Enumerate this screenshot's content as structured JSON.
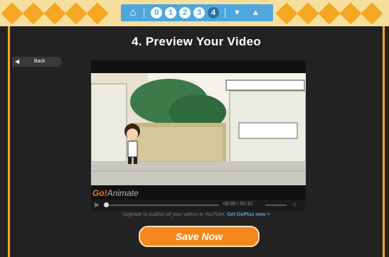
{
  "nav": {
    "home_icon": "home-icon",
    "steps": [
      "0",
      "1",
      "2",
      "3",
      "4"
    ],
    "current_step": "4"
  },
  "page": {
    "title": "4. Preview Your Video"
  },
  "back": {
    "label": "Back"
  },
  "player": {
    "logo_go": "Go!",
    "logo_rest": "Animate",
    "time": "00:00 / 00:10"
  },
  "upgrade": {
    "text": "Upgrade to publish all your videos to YouTube.",
    "link": "Get GoPlus now >"
  },
  "save": {
    "label": "Save Now"
  },
  "colors": {
    "accent_orange": "#f5a623",
    "nav_blue": "#4fa7dd",
    "background": "#222222"
  }
}
